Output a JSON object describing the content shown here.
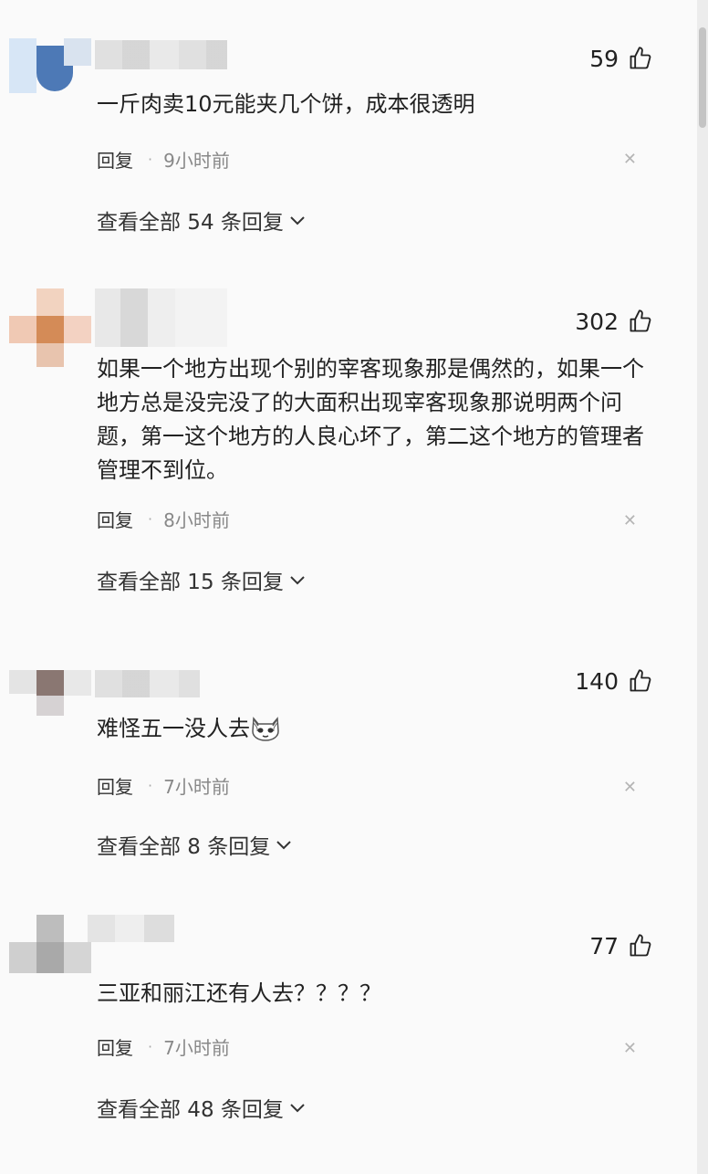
{
  "comments": [
    {
      "likes": "59",
      "text": "一斤肉卖10元能夹几个饼，成本很透明",
      "reply_label": "回复",
      "time": "9小时前",
      "view_all_label": "查看全部 54 条回复"
    },
    {
      "likes": "302",
      "text": "如果一个地方出现个别的宰客现象那是偶然的，如果一个地方总是没完没了的大面积出现宰客现象那说明两个问题，第一这个地方的人良心坏了，第二这个地方的管理者管理不到位。",
      "reply_label": "回复",
      "time": "8小时前",
      "view_all_label": "查看全部 15 条回复"
    },
    {
      "likes": "140",
      "text": "难怪五一没人去",
      "emoji": "cat-emoji",
      "reply_label": "回复",
      "time": "7小时前",
      "view_all_label": "查看全部 8 条回复"
    },
    {
      "likes": "77",
      "text": "三亚和丽江还有人去？？？？",
      "reply_label": "回复",
      "time": "7小时前",
      "view_all_label": "查看全部 48 条回复"
    }
  ],
  "icons": {
    "like": "thumbs-up-icon",
    "close": "close-icon",
    "expand": "chevron-down-icon"
  },
  "colors": {
    "text": "#222222",
    "muted": "#888888",
    "background": "#fafafa"
  }
}
